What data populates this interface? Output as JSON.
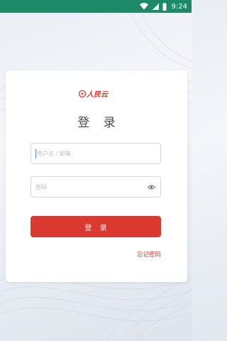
{
  "status_bar": {
    "time": "9:24",
    "icons": [
      "wifi-icon",
      "signal-icon",
      "battery-icon"
    ],
    "color": "#1c8a66"
  },
  "login_card": {
    "logo_text": "人民云",
    "title": "登 录",
    "username": {
      "placeholder": "用户名 / 邮箱",
      "value": ""
    },
    "password": {
      "placeholder": "密码",
      "value": "",
      "toggle_icon": "eye-icon"
    },
    "login_button_label": "登 录",
    "forgot_password_label": "忘记密码"
  },
  "colors": {
    "accent_red": "#d9392f",
    "card_bg": "#ffffff",
    "status_green": "#1c8a66"
  }
}
